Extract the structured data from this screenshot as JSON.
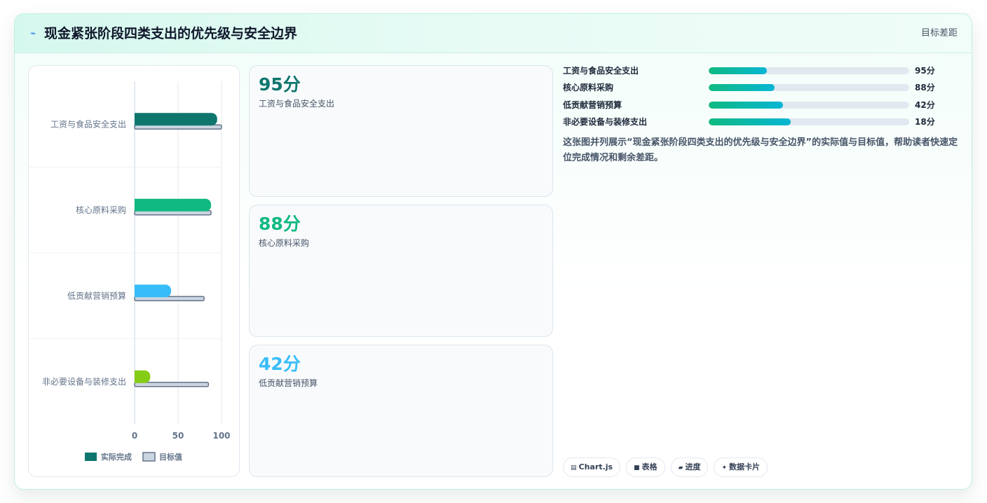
{
  "header": {
    "icon": "trend-icon",
    "title": "现金紧张阶段四类支出的优先级与安全边界",
    "right_label": "目标差距"
  },
  "chart_data": {
    "type": "bar",
    "orientation": "horizontal",
    "categories": [
      "工资与食品安全支出",
      "核心原料采购",
      "低贡献营销预算",
      "非必要设备与装修支出"
    ],
    "series": [
      {
        "name": "实际完成",
        "values": [
          95,
          88,
          42,
          18
        ],
        "colors": [
          "#0f766e",
          "#10b981",
          "#38bdf8",
          "#84cc16"
        ]
      },
      {
        "name": "目标值",
        "values": [
          100,
          88,
          80,
          85
        ],
        "color": "#cbd5e1",
        "border_color": "#64748b"
      }
    ],
    "xlim": [
      0,
      100
    ],
    "x_ticks": [
      0,
      50,
      100
    ],
    "grid": true,
    "legend_position": "bottom"
  },
  "kpis": [
    {
      "value": "95分",
      "label": "工资与食品安全支出",
      "color": "#0f766e"
    },
    {
      "value": "88分",
      "label": "核心原料采购",
      "color": "#10b981"
    },
    {
      "value": "42分",
      "label": "低贡献营销预算",
      "color": "#38bdf8"
    }
  ],
  "progress": [
    {
      "label": "工资与食品安全支出",
      "value_text": "95分",
      "fraction": 0.29
    },
    {
      "label": "核心原料采购",
      "value_text": "88分",
      "fraction": 0.33
    },
    {
      "label": "低贡献营销预算",
      "value_text": "42分",
      "fraction": 0.37
    },
    {
      "label": "非必要设备与装修支出",
      "value_text": "18分",
      "fraction": 0.41
    }
  ],
  "description": "这张图并列展示“现金紧张阶段四类支出的优先级与安全边界”的实际值与目标值，帮助读者快速定位完成情况和剩余差距。",
  "tags": [
    {
      "icon": "chart-icon",
      "glyph": "▤",
      "label": "Chart.js"
    },
    {
      "icon": "table-icon",
      "glyph": "■",
      "label": "表格"
    },
    {
      "icon": "progress-icon",
      "glyph": "▰",
      "label": "进度"
    },
    {
      "icon": "sparkle-icon",
      "glyph": "✦",
      "label": "数据卡片"
    }
  ]
}
